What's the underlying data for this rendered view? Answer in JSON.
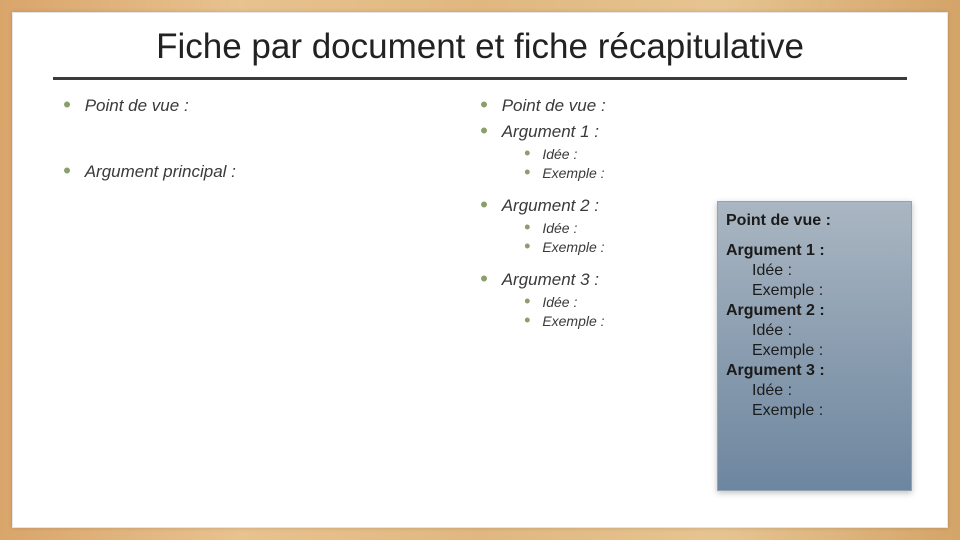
{
  "title": "Fiche par document et fiche récapitulative",
  "left": {
    "pov": "Point de vue :",
    "argp": "Argument principal :"
  },
  "right": {
    "pov": "Point de vue :",
    "arg1": "Argument 1 :",
    "arg2": "Argument 2 :",
    "arg3": "Argument 3 :",
    "idee": "Idée :",
    "exemple": "Exemple :"
  },
  "overlay": {
    "pov": "Point de vue :",
    "arg1": "Argument 1 :",
    "arg2": "Argument 2 :",
    "arg3": "Argument 3 :",
    "idee": "Idée :",
    "exemple": "Exemple :"
  }
}
